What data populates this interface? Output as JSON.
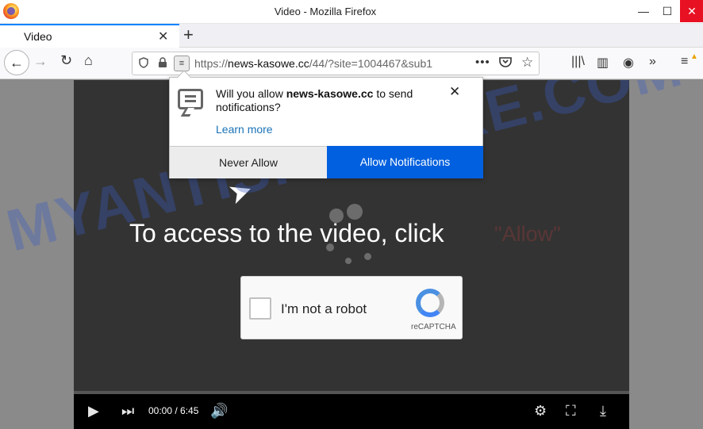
{
  "window": {
    "title": "Video - Mozilla Firefox",
    "minimize_glyph": "—",
    "maximize_glyph": "☐",
    "close_glyph": "✕"
  },
  "tab": {
    "title": "Video",
    "close_glyph": "✕",
    "new_tab_glyph": "+"
  },
  "nav": {
    "back_glyph": "←",
    "forward_glyph": "→",
    "reload_glyph": "↻",
    "home_glyph": "⌂",
    "url_scheme": "https://",
    "url_host": "news-kasowe.cc",
    "url_path": "/44/?site=1004467&sub1",
    "page_actions_glyph": "•••",
    "pocket_glyph": "◡",
    "bookmark_glyph": "☆",
    "library_glyph": "|||\\",
    "sidebar_glyph": "▥",
    "account_glyph": "◉",
    "overflow_glyph": "»",
    "menu_glyph": "≡",
    "update_badge_glyph": "▲"
  },
  "notification": {
    "msg_prefix": "Will you allow ",
    "msg_host": "news-kasowe.cc",
    "msg_suffix": " to send notifications?",
    "learn_more": "Learn more",
    "close_glyph": "✕",
    "never_allow": "Never Allow",
    "allow": "Allow Notifications"
  },
  "video": {
    "headline": "To access to the video, click",
    "headline_allow": "\"Allow\"",
    "time": "00:00 / 6:45",
    "progress": 0.0,
    "play_glyph": "▶",
    "next_glyph": "⏭",
    "volume_glyph": "🔊",
    "settings_glyph": "⚙",
    "fullscreen_glyph": "⛶",
    "download_glyph": "⤓",
    "cursor_glyph": "➤"
  },
  "captcha": {
    "label": "I'm not a robot",
    "brand": "reCAPTCHA"
  },
  "watermark": {
    "text": "MYANTISPYWARE.COM"
  },
  "colors": {
    "allow_button": "#0060df",
    "close_button": "#e81123",
    "watermark": "#3b5cc4"
  }
}
